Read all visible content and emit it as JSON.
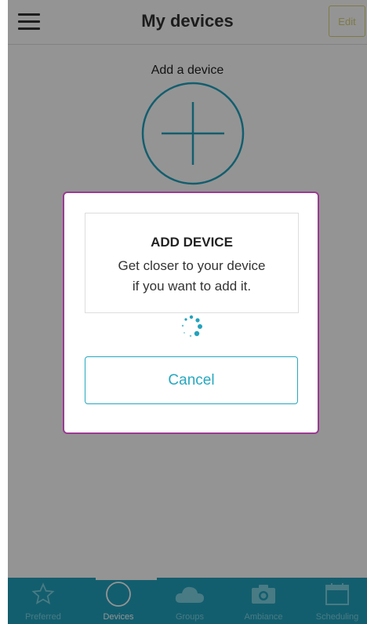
{
  "header": {
    "title": "My devices",
    "edit_label": "Edit"
  },
  "main": {
    "add_device_label": "Add a device"
  },
  "dialog": {
    "title": "ADD DEVICE",
    "message_line1": "Get closer to your device",
    "message_line2": "if you want to add it.",
    "cancel_label": "Cancel"
  },
  "bottom_nav": {
    "items": [
      {
        "label": "Preferred",
        "icon": "star-icon"
      },
      {
        "label": "Devices",
        "icon": "circle-icon"
      },
      {
        "label": "Groups",
        "icon": "cloud-icon"
      },
      {
        "label": "Ambiance",
        "icon": "camera-icon"
      },
      {
        "label": "Scheduling",
        "icon": "calendar-icon"
      }
    ],
    "active_index": 1
  },
  "colors": {
    "accent": "#21a3bd",
    "dialog_border": "#9c3a93",
    "edit": "#d9d27a"
  }
}
